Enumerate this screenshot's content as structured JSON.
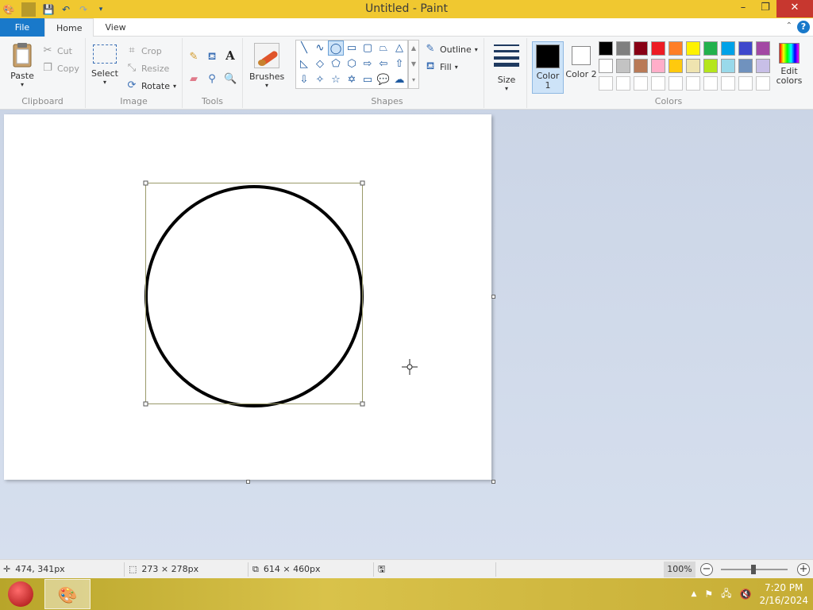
{
  "window": {
    "title": "Untitled - Paint",
    "minimize": "–",
    "restore": "❐",
    "close": "✕"
  },
  "tabs": [
    {
      "label": "File"
    },
    {
      "label": "Home"
    },
    {
      "label": "View"
    }
  ],
  "ribbon": {
    "clipboard": {
      "label": "Clipboard",
      "paste": "Paste",
      "cut": "Cut",
      "copy": "Copy"
    },
    "image": {
      "label": "Image",
      "select": "Select",
      "crop": "Crop",
      "resize": "Resize",
      "rotate": "Rotate"
    },
    "tools": {
      "label": "Tools"
    },
    "brushes": {
      "label": "Brushes"
    },
    "shapes": {
      "label": "Shapes",
      "outline": "Outline",
      "fill": "Fill"
    },
    "size": {
      "label": "Size"
    },
    "colors": {
      "label": "Colors",
      "color1": "Color 1",
      "color2": "Color 2",
      "edit": "Edit colors",
      "palette_row1": [
        "#000000",
        "#7f7f7f",
        "#880015",
        "#ed1c24",
        "#ff7f27",
        "#fff200",
        "#22b14c",
        "#00a2e8",
        "#3f48cc",
        "#a349a4"
      ],
      "palette_row2": [
        "#ffffff",
        "#c3c3c3",
        "#b97a57",
        "#ffaec9",
        "#ffc90e",
        "#efe4b0",
        "#b5e61d",
        "#99d9ea",
        "#7092be",
        "#c8bfe7"
      ],
      "palette_row3": [
        "#ffffff",
        "#ffffff",
        "#ffffff",
        "#ffffff",
        "#ffffff",
        "#ffffff",
        "#ffffff",
        "#ffffff",
        "#ffffff",
        "#ffffff"
      ],
      "color1_value": "#000000",
      "color2_value": "#ffffff"
    }
  },
  "statusbar": {
    "cursor_pos": "474, 341px",
    "selection_size": "273 × 278px",
    "canvas_size": "614 × 460px",
    "zoom": "100%"
  },
  "taskbar": {
    "time": "7:20 PM",
    "date": "2/16/2024"
  }
}
